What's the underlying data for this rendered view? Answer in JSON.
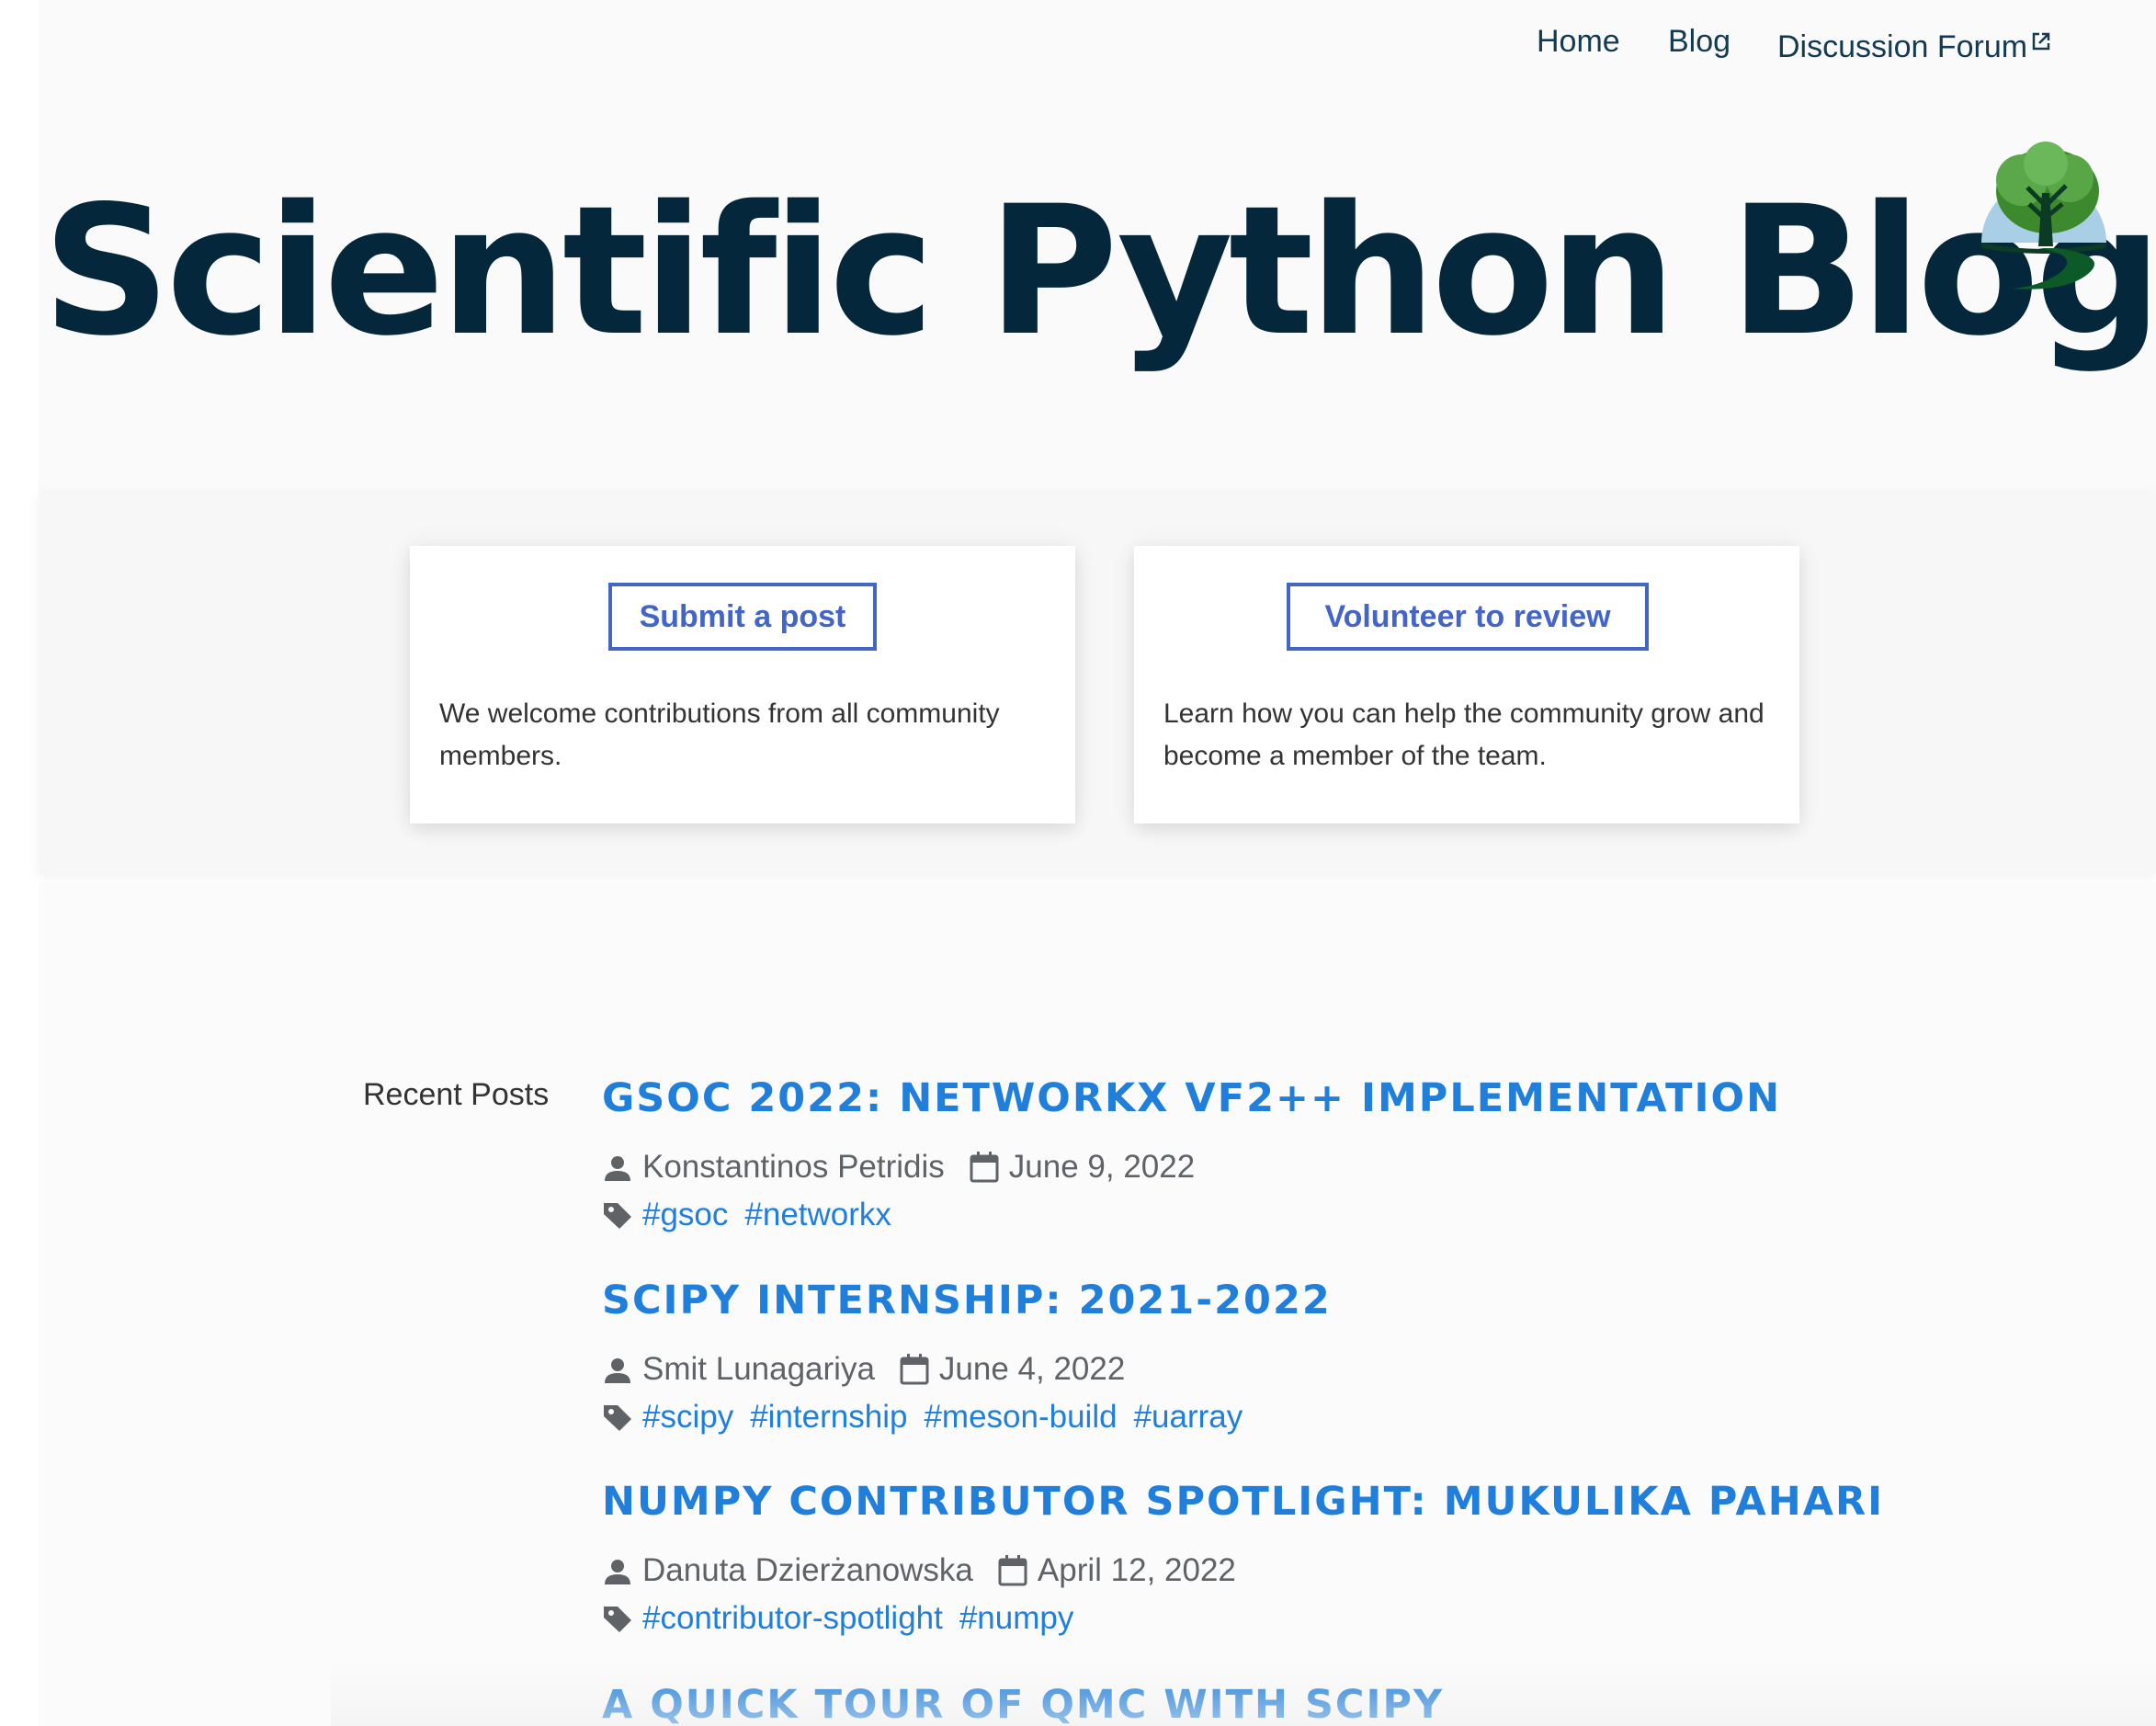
{
  "nav": {
    "home": "Home",
    "blog": "Blog",
    "forum": "Discussion Forum",
    "forum_icon": "external-link-icon"
  },
  "site": {
    "title": "Scientific Python Blog",
    "logo_icon": "tree-logo-icon"
  },
  "cards": [
    {
      "button": "Submit a post",
      "text": "We welcome contributions from all community members."
    },
    {
      "button": "Volunteer to review",
      "text": "Learn how you can help the community grow and become a member of the team."
    }
  ],
  "recent": {
    "label": "Recent Posts",
    "posts": [
      {
        "title": "GSOC 2022: NETWORKX VF2++ IMPLEMENTATION",
        "author": "Konstantinos Petridis",
        "date": "June 9, 2022",
        "tags": [
          "#gsoc",
          "#networkx"
        ]
      },
      {
        "title": "SCIPY INTERNSHIP: 2021-2022",
        "author": "Smit Lunagariya",
        "date": "June 4, 2022",
        "tags": [
          "#scipy",
          "#internship",
          "#meson-build",
          "#uarray"
        ]
      },
      {
        "title": "NUMPY CONTRIBUTOR SPOTLIGHT: MUKULIKA PAHARI",
        "author": "Danuta Dzierżanowska",
        "date": "April 12, 2022",
        "tags": [
          "#contributor-spotlight",
          "#numpy"
        ]
      },
      {
        "title": "A QUICK TOUR OF QMC WITH SCIPY"
      }
    ]
  },
  "colors": {
    "title": "#04273c",
    "nav": "#143a52",
    "button_border": "#4365c8",
    "post_link": "#1f7fdb",
    "meta_text": "#5f6368"
  }
}
